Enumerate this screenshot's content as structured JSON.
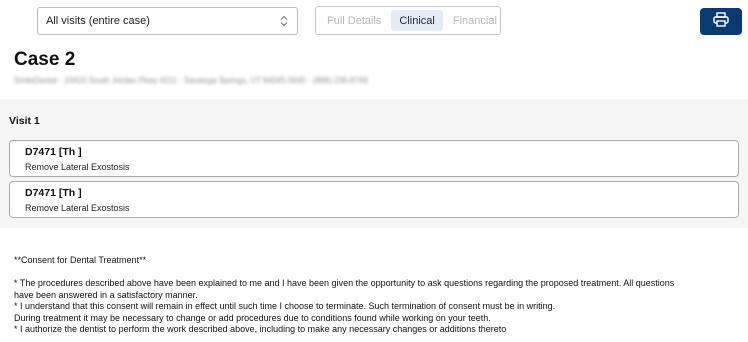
{
  "toolbar": {
    "visit_select": {
      "value": "All visits (entire case)"
    },
    "view_tabs": [
      {
        "label": "Full Details",
        "active": false
      },
      {
        "label": "Clinical",
        "active": true
      },
      {
        "label": "Financial",
        "active": false
      }
    ],
    "print_icon": "printer-icon",
    "accent_color": "#0b3a73"
  },
  "header": {
    "title": "Case 2",
    "address": "SmileDental · 10415 South Jordan Pkwy #211 · Saratoga Springs, UT 84045-5645 · (888) 236-8749"
  },
  "visit": {
    "title": "Visit 1",
    "procedures": [
      {
        "code": "D7471 [Th ]",
        "description": "Remove Lateral Exostosis"
      },
      {
        "code": "D7471 [Th ]",
        "description": "Remove Lateral Exostosis"
      }
    ]
  },
  "consent": {
    "heading": "**Consent for Dental Treatment**",
    "lines": [
      "* The procedures described above have been explained to me and I have been given the opportunity to ask questions regarding the proposed treatment. All questions",
      "have been answered in a satisfactory manner.",
      "* I understand that this consent will remain in effect until such time I choose to terminate. Such termination of consent must be in writing.",
      "During treatment it may be necessary to change or add procedures due to conditions found while working on your teeth.",
      "* I authorize the dentist to perform the work described above, including to make any necessary changes or additions thereto"
    ]
  }
}
